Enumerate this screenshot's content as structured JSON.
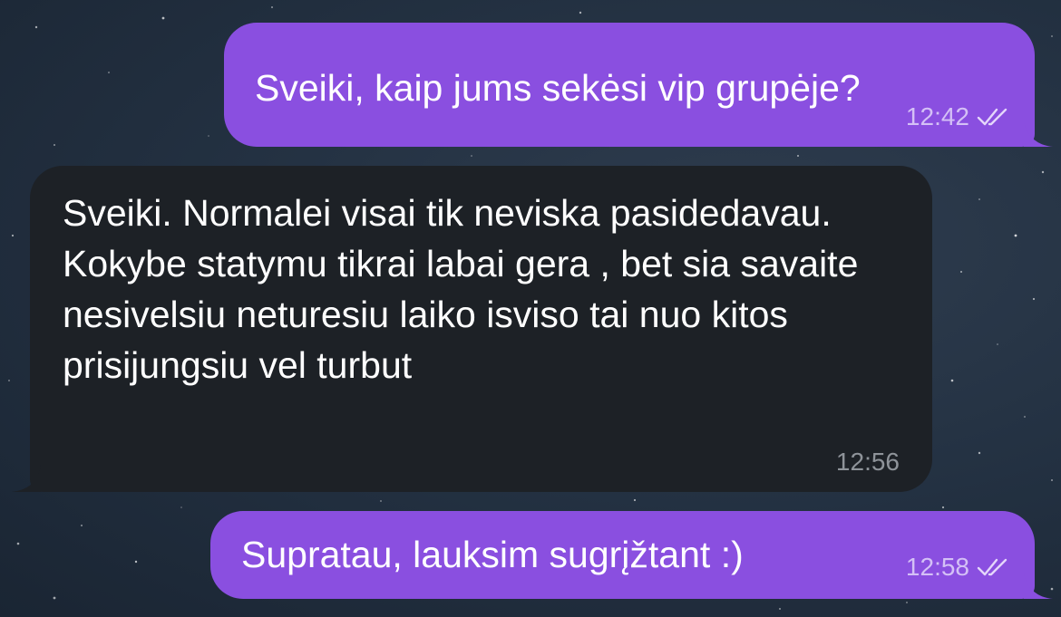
{
  "chat": {
    "messages": [
      {
        "direction": "outgoing",
        "text": "Sveiki, kaip jums sekėsi vip grupėje?",
        "time": "12:42",
        "status_icon": "double-check-icon"
      },
      {
        "direction": "incoming",
        "text": "Sveiki. Normalei visai tik neviska pasidedavau. Kokybe statymu tikrai labai gera , bet sia savaite nesivelsiu neturesiu laiko isviso tai nuo kitos prisijungsiu vel turbut",
        "time": "12:56"
      },
      {
        "direction": "outgoing",
        "text": "Supratau, lauksim sugrįžtant :)",
        "time": "12:58",
        "status_icon": "double-check-icon"
      }
    ]
  },
  "colors": {
    "outgoing_bubble": "#8a4fe0",
    "incoming_bubble": "#1d2126",
    "background": "#243243",
    "outgoing_time": "#d4c0f6",
    "incoming_time": "#8e9399"
  }
}
